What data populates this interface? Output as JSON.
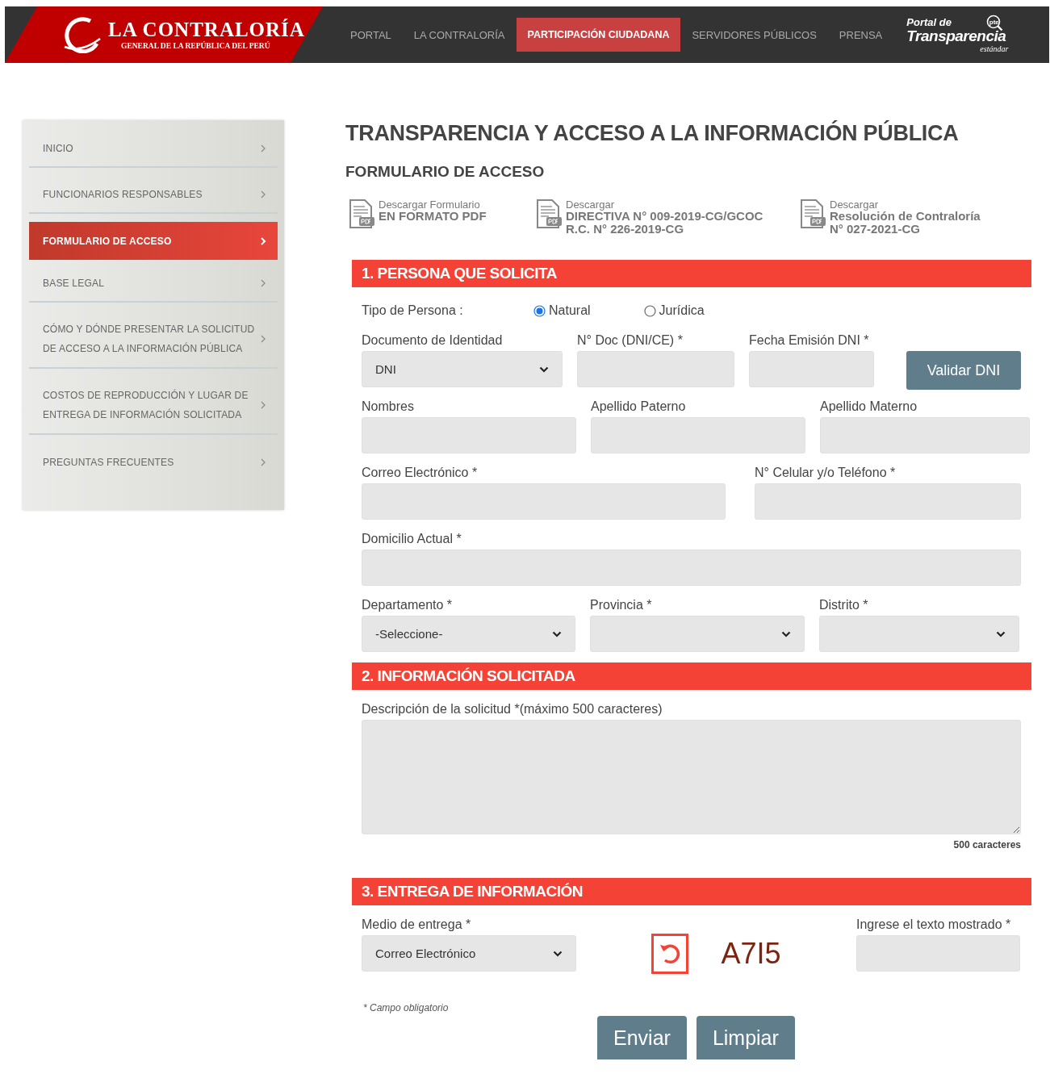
{
  "header": {
    "logo": {
      "title": "LA CONTRALORÍA",
      "subtitle": "GENERAL DE LA REPÚBLICA DEL PERÚ"
    },
    "nav": [
      {
        "label": "PORTAL",
        "selected": false
      },
      {
        "label": "LA CONTRALORÍA",
        "selected": false
      },
      {
        "label": "PARTICIPACIÓN CIUDADANA",
        "selected": true
      },
      {
        "label": "SERVIDORES PÚBLICOS",
        "selected": false
      },
      {
        "label": "PRENSA",
        "selected": false
      }
    ],
    "transparency": {
      "line1": "Portal de",
      "line2": "Transparencia",
      "line3": "estándar",
      "badge": "pte"
    }
  },
  "sidebar": {
    "items": [
      {
        "label": "INICIO",
        "selected": false
      },
      {
        "label": "FUNCIONARIOS RESPONSABLES",
        "selected": false
      },
      {
        "label": "FORMULARIO DE ACCESO",
        "selected": true
      },
      {
        "label": "BASE LEGAL",
        "selected": false
      },
      {
        "label": "CÓMO Y DÓNDE PRESENTAR LA SOLICITUD DE ACCESO A LA INFORMACIÓN PÚBLICA",
        "selected": false
      },
      {
        "label": "COSTOS DE REPRODUCCIÓN Y LUGAR DE ENTREGA DE INFORMACIÓN SOLICITADA",
        "selected": false
      },
      {
        "label": "PREGUNTAS FRECUENTES",
        "selected": false
      }
    ]
  },
  "title": "TRANSPARENCIA Y ACCESO A LA INFORMACIÓN PÚBLICA",
  "subtitle": "FORMULARIO DE ACCESO",
  "downloads": [
    {
      "caption": "Descargar Formulario",
      "lines": [
        "EN FORMATO PDF"
      ]
    },
    {
      "caption": "Descargar",
      "lines": [
        "DIRECTIVA N° 009-2019-CG/GCOC",
        "R.C. N° 226-2019-CG"
      ]
    },
    {
      "caption": "Descargar",
      "lines": [
        "Resolución de Contraloría",
        "N° 027-2021-CG"
      ]
    }
  ],
  "sections": [
    {
      "title": "1. PERSONA QUE SOLICITA",
      "rows": [
        {
          "fields": [
            {
              "kind": "radio",
              "label": "Tipo de Persona :",
              "options": [
                {
                  "label": "Natural",
                  "selected": true
                },
                {
                  "label": "Jurídica",
                  "selected": false
                }
              ]
            }
          ]
        },
        {
          "fields": [
            {
              "kind": "select",
              "label": "Documento de Identidad",
              "value": "DNI"
            },
            {
              "kind": "input",
              "label": "N° Doc (DNI/CE) *"
            },
            {
              "kind": "input",
              "label": "Fecha Emisión DNI *"
            },
            {
              "kind": "button",
              "label": "Validar DNI"
            }
          ]
        },
        {
          "fields": [
            {
              "kind": "input",
              "label": "Nombres"
            },
            {
              "kind": "input",
              "label": "Apellido Paterno"
            },
            {
              "kind": "input",
              "label": "Apellido Materno"
            }
          ]
        },
        {
          "fields": [
            {
              "kind": "input",
              "label": "Correo Electrónico *"
            },
            {
              "kind": "input",
              "label": "N° Celular y/o Teléfono *"
            }
          ]
        },
        {
          "fields": [
            {
              "kind": "input",
              "label": "Domicilio Actual *"
            }
          ]
        },
        {
          "fields": [
            {
              "kind": "select",
              "label": "Departamento *",
              "value": "-Seleccione-"
            },
            {
              "kind": "select",
              "label": "Provincia *"
            },
            {
              "kind": "select",
              "label": "Distrito *"
            }
          ]
        }
      ]
    },
    {
      "title": "2. INFORMACIÓN SOLICITADA",
      "rows": [
        {
          "fields": [
            {
              "kind": "textarea",
              "label": "Descripción de la solicitud *(máximo 500 caracteres)",
              "counter": "500 caracteres"
            }
          ]
        }
      ]
    },
    {
      "title": "3. ENTREGA DE INFORMACIÓN",
      "rows": [
        {
          "fields": [
            {
              "kind": "select",
              "label": "Medio de entrega *",
              "value": "Correo Electrónico"
            },
            {
              "kind": "captcha",
              "code": "A7I5"
            },
            {
              "kind": "input",
              "label": "Ingrese el texto mostrado *"
            }
          ]
        }
      ]
    }
  ],
  "note": "* Campo obligatorio",
  "buttons": [
    "Enviar",
    "Limpiar"
  ]
}
